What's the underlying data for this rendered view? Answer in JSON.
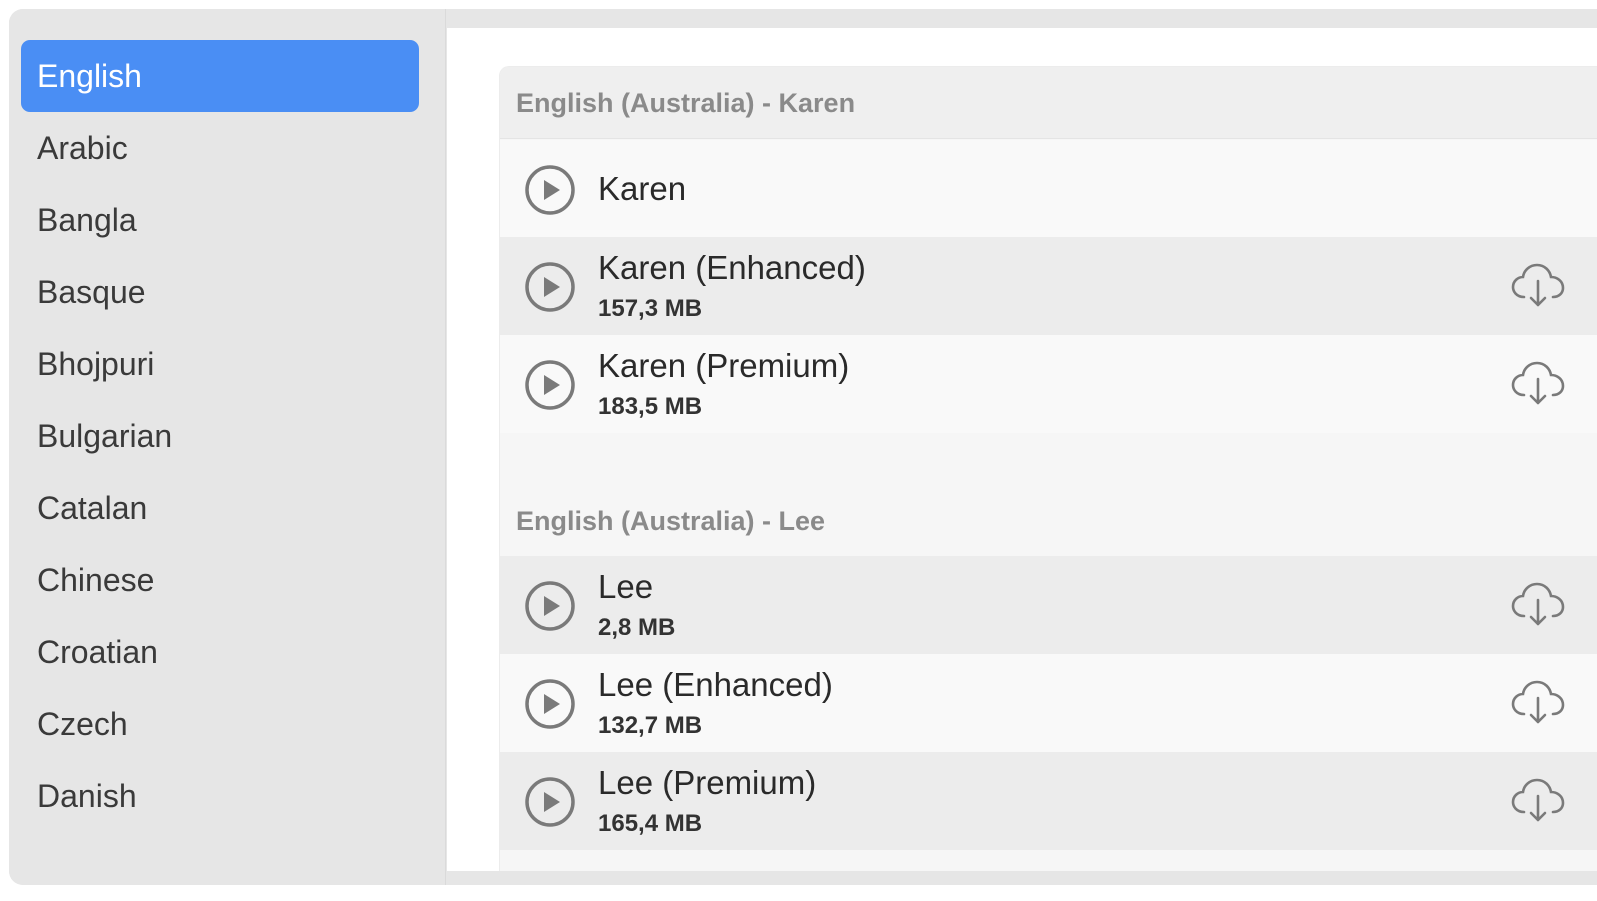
{
  "sidebar": {
    "languages": [
      {
        "label": "English",
        "selected": true
      },
      {
        "label": "Arabic",
        "selected": false
      },
      {
        "label": "Bangla",
        "selected": false
      },
      {
        "label": "Basque",
        "selected": false
      },
      {
        "label": "Bhojpuri",
        "selected": false
      },
      {
        "label": "Bulgarian",
        "selected": false
      },
      {
        "label": "Catalan",
        "selected": false
      },
      {
        "label": "Chinese",
        "selected": false
      },
      {
        "label": "Croatian",
        "selected": false
      },
      {
        "label": "Czech",
        "selected": false
      },
      {
        "label": "Danish",
        "selected": false
      }
    ]
  },
  "groups": [
    {
      "title": "English (Australia) - Karen",
      "voices": [
        {
          "name": "Karen",
          "size": "",
          "downloadable": false
        },
        {
          "name": "Karen (Enhanced)",
          "size": "157,3 MB",
          "downloadable": true
        },
        {
          "name": "Karen (Premium)",
          "size": "183,5 MB",
          "downloadable": true
        }
      ]
    },
    {
      "title": "English (Australia) - Lee",
      "voices": [
        {
          "name": "Lee",
          "size": "2,8 MB",
          "downloadable": true
        },
        {
          "name": "Lee (Enhanced)",
          "size": "132,7 MB",
          "downloadable": true
        },
        {
          "name": "Lee (Premium)",
          "size": "165,4 MB",
          "downloadable": true
        }
      ]
    }
  ],
  "icons": {
    "play": "play-circle-icon",
    "download": "cloud-download-icon"
  },
  "colors": {
    "accent": "#4a8ef4",
    "sidebar_bg": "#e6e6e6",
    "icon_gray": "#7a7a7a"
  }
}
